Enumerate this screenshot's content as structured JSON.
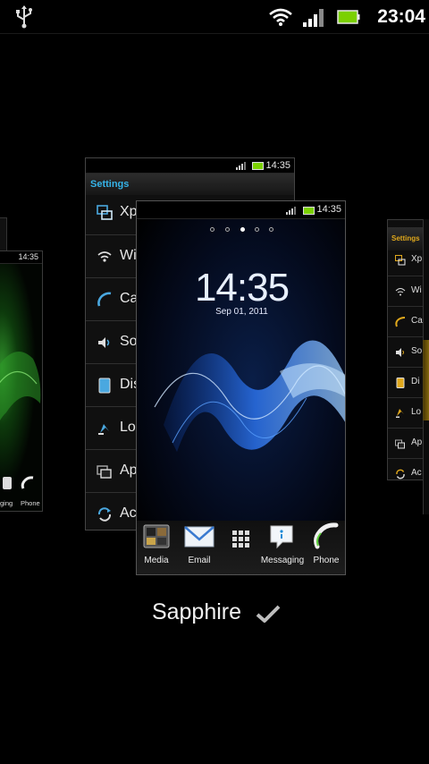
{
  "status_bar": {
    "time": "23:04",
    "icons": [
      "usb-icon",
      "wifi-icon",
      "signal-icon",
      "battery-icon"
    ]
  },
  "back_panel": {
    "status_time": "14:35",
    "title": "Settings",
    "title_color": "#35b3e8",
    "rows": [
      {
        "label": "Xp",
        "icon": "xperia-icon"
      },
      {
        "label": "Wi",
        "icon": "wifi-icon"
      },
      {
        "label": "Ca",
        "icon": "call-icon"
      },
      {
        "label": "So",
        "icon": "sound-icon"
      },
      {
        "label": "Dis",
        "icon": "display-icon"
      },
      {
        "label": "Lo",
        "icon": "location-icon"
      },
      {
        "label": "Ap",
        "icon": "apps-icon"
      },
      {
        "label": "Ac",
        "icon": "sync-icon"
      }
    ]
  },
  "front_panel": {
    "status_time": "14:35",
    "clock": "14:35",
    "date": "Sep 01, 2011",
    "pages": 5,
    "current_page": 3,
    "dock": [
      {
        "label": "Media",
        "icon": "media-icon"
      },
      {
        "label": "Email",
        "icon": "email-icon"
      },
      {
        "label": "",
        "icon": "app-grid-icon"
      },
      {
        "label": "Messaging",
        "icon": "messaging-icon"
      },
      {
        "label": "Phone",
        "icon": "phone-icon"
      }
    ]
  },
  "left_panel": {
    "status_time": "14:35",
    "dock_labels": [
      "ging",
      "Phone"
    ]
  },
  "right_panel": {
    "title": "Settings",
    "title_color": "#e0a81c",
    "rows": [
      {
        "label": "Xp",
        "icon": "xperia-icon"
      },
      {
        "label": "Wi",
        "icon": "wifi-icon"
      },
      {
        "label": "Ca",
        "icon": "call-icon"
      },
      {
        "label": "So",
        "icon": "sound-icon"
      },
      {
        "label": "Di",
        "icon": "display-icon"
      },
      {
        "label": "Lo",
        "icon": "location-icon"
      },
      {
        "label": "Ap",
        "icon": "apps-icon"
      },
      {
        "label": "Ac",
        "icon": "sync-icon"
      }
    ]
  },
  "theme": {
    "name": "Sapphire",
    "selected_icon": "checkmark-icon"
  }
}
